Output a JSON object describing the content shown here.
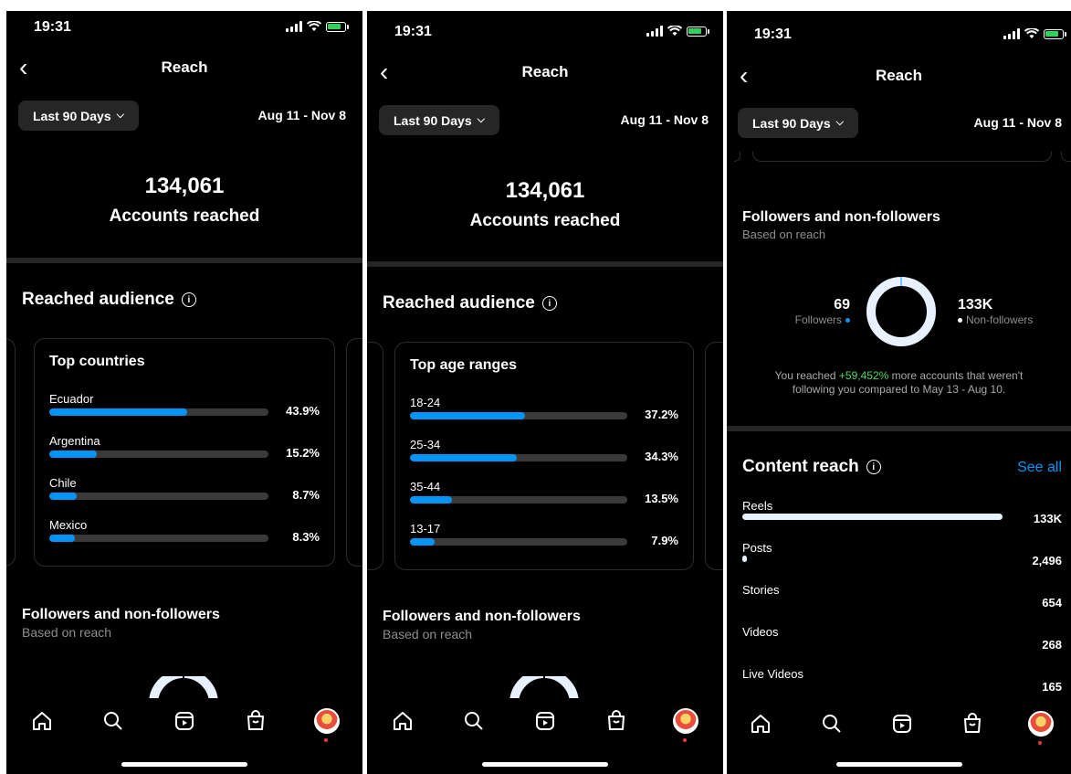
{
  "status": {
    "time": "19:31"
  },
  "header": {
    "title": "Reach"
  },
  "filter": {
    "period": "Last 90 Days",
    "date_range": "Aug 11 - Nov 8"
  },
  "reach": {
    "total": "134,061",
    "label": "Accounts reached"
  },
  "audience": {
    "title": "Reached audience",
    "countries": {
      "title": "Top countries",
      "items": [
        {
          "label": "Ecuador",
          "value": "43.9%",
          "pct": 43.9
        },
        {
          "label": "Argentina",
          "value": "15.2%",
          "pct": 15.2
        },
        {
          "label": "Chile",
          "value": "8.7%",
          "pct": 8.7
        },
        {
          "label": "Mexico",
          "value": "8.3%",
          "pct": 8.3
        }
      ]
    },
    "ages": {
      "title": "Top age ranges",
      "items": [
        {
          "label": "18-24",
          "value": "37.2%",
          "pct": 37.2
        },
        {
          "label": "25-34",
          "value": "34.3%",
          "pct": 34.3
        },
        {
          "label": "35-44",
          "value": "13.5%",
          "pct": 13.5
        },
        {
          "label": "13-17",
          "value": "7.9%",
          "pct": 7.9
        }
      ]
    }
  },
  "followers": {
    "title": "Followers and non-followers",
    "subtitle": "Based on reach",
    "followers_count": "69",
    "followers_label": "Followers",
    "non_followers_count": "133K",
    "non_followers_label": "Non-followers",
    "note_prefix": "You reached",
    "note_highlight": "+59,452%",
    "note_suffix": "more accounts that weren't following you compared to May 13 - Aug 10."
  },
  "content_reach": {
    "title": "Content reach",
    "see_all": "See all",
    "items": [
      {
        "label": "Reels",
        "value": "133K",
        "pct": 100
      },
      {
        "label": "Posts",
        "value": "2,496",
        "pct": 1.9
      },
      {
        "label": "Stories",
        "value": "654",
        "pct": 0
      },
      {
        "label": "Videos",
        "value": "268",
        "pct": 0
      },
      {
        "label": "Live Videos",
        "value": "165",
        "pct": 0
      }
    ]
  },
  "colors": {
    "accent": "#0095f6",
    "background": "#000000",
    "positive": "#4cd964"
  },
  "nav": {
    "icons": [
      "home-icon",
      "search-icon",
      "reels-icon",
      "shop-icon",
      "profile-avatar"
    ]
  }
}
